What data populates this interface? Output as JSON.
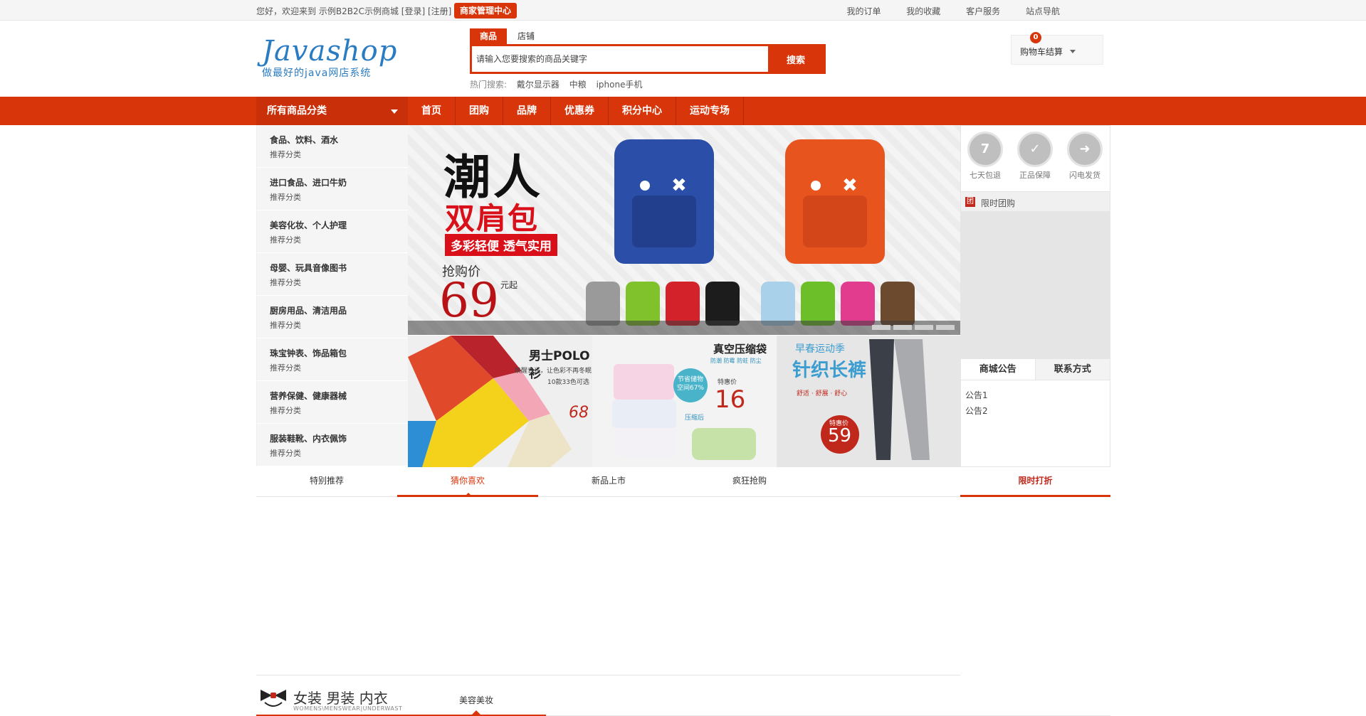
{
  "topbar": {
    "welcome_prefix": "您好，欢迎来到",
    "site_name": "示例B2B2C示例商城",
    "login": "[登录]",
    "register": "[注册]",
    "merchant_center": "商家管理中心",
    "links": [
      "我的订单",
      "我的收藏",
      "客户服务",
      "站点导航"
    ]
  },
  "logo": {
    "main": "Javashop",
    "sub": "做最好的java网店系统"
  },
  "search": {
    "tabs": [
      "商品",
      "店铺"
    ],
    "placeholder": "请输入您要搜索的商品关键字",
    "button": "搜索",
    "hot_label": "热门搜索:",
    "hot_keywords": [
      "戴尔显示器",
      "中粮",
      "iphone手机"
    ]
  },
  "cart": {
    "label": "购物车结算",
    "count": "0"
  },
  "nav": {
    "all_categories": "所有商品分类",
    "items": [
      "首页",
      "团购",
      "品牌",
      "优惠券",
      "积分中心",
      "运动专场"
    ]
  },
  "categories": [
    {
      "title": "食品、饮料、酒水",
      "sub": "推荐分类"
    },
    {
      "title": "进口食品、进口牛奶",
      "sub": "推荐分类"
    },
    {
      "title": "美容化妆、个人护理",
      "sub": "推荐分类"
    },
    {
      "title": "母婴、玩具音像图书",
      "sub": "推荐分类"
    },
    {
      "title": "厨房用品、清洁用品",
      "sub": "推荐分类"
    },
    {
      "title": "珠宝钟表、饰品箱包",
      "sub": "推荐分类"
    },
    {
      "title": "营养保健、健康器械",
      "sub": "推荐分类"
    },
    {
      "title": "服装鞋靴、内衣佩饰",
      "sub": "推荐分类"
    }
  ],
  "banner": {
    "title": "潮人",
    "title2": "双肩包",
    "tag": "多彩轻便  透气实用",
    "price_label": "抢购价",
    "price": "69",
    "price_unit": "元起"
  },
  "promos": [
    {
      "title": "男士POLO衫",
      "line1": "焕醒青光，让色彩不再冬眠",
      "line2": "10款33色可选",
      "price": "68"
    },
    {
      "title": "真空压缩袋",
      "badge": "节省储物空间67%",
      "tags": "防潮 防霉 防蛀 防尘",
      "price_label": "特惠价",
      "price": "16",
      "note": "压缩后"
    },
    {
      "title": "针织长裤",
      "subtitle": "早春运动季",
      "tags": "舒适 · 舒展 · 舒心",
      "price_label": "特惠价",
      "price": "59"
    }
  ],
  "services": [
    {
      "icon": "seven-day-return-icon",
      "glyph": "7",
      "label": "七天包退"
    },
    {
      "icon": "genuine-guarantee-icon",
      "glyph": "✓",
      "label": "正品保障"
    },
    {
      "icon": "fast-delivery-icon",
      "glyph": "➜",
      "label": "闪电发货"
    }
  ],
  "group_buy": {
    "badge": "团",
    "label": "限时团购"
  },
  "announcement": {
    "tabs": [
      "商城公告",
      "联系方式"
    ],
    "items": [
      "公告1",
      "公告2"
    ]
  },
  "product_tabs": [
    "特别推荐",
    "猜你喜欢",
    "新品上市",
    "疯狂抢购"
  ],
  "active_product_tab": 1,
  "discount_tab": "限时打折",
  "floor": {
    "title": "女装 男装 内衣",
    "subtitle": "WOMENS\\MENSWEAR|UNDERWAST",
    "tab": "美容美妆"
  },
  "colors": {
    "brand": "#d9350a",
    "brand_dark": "#c92f08",
    "logo_blue": "#2a7cc2"
  }
}
